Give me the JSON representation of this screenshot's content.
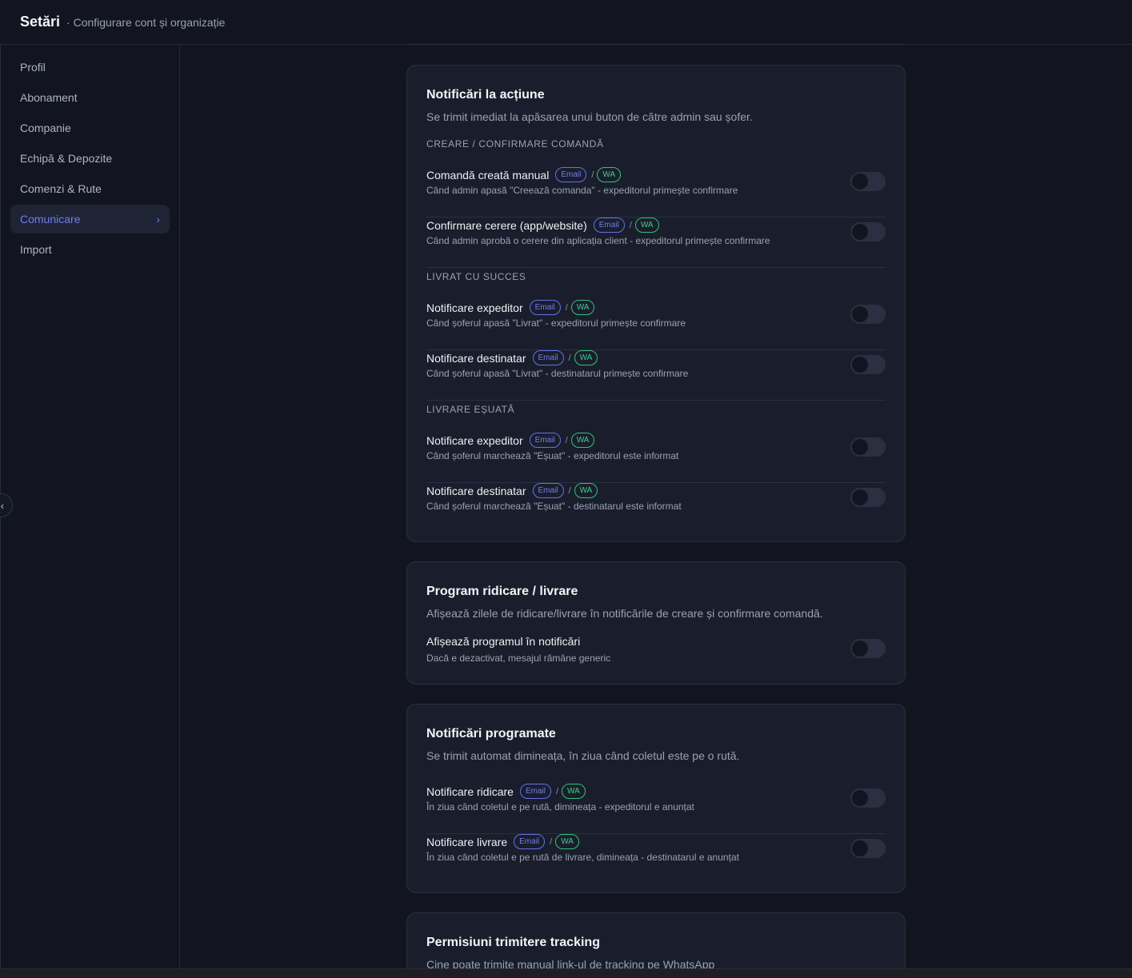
{
  "header": {
    "title": "Setări",
    "subtitle": "· Configurare cont și organizație"
  },
  "sidebar": {
    "items": [
      {
        "label": "Profil"
      },
      {
        "label": "Abonament"
      },
      {
        "label": "Companie"
      },
      {
        "label": "Echipă & Depozite"
      },
      {
        "label": "Comenzi & Rute"
      },
      {
        "label": "Comunicare",
        "active": true
      },
      {
        "label": "Import"
      }
    ],
    "active_chevron": "›",
    "collapse_icon": "‹"
  },
  "badges": {
    "email": "Email",
    "slash": "/",
    "wa": "WA"
  },
  "cards": {
    "action": {
      "title": "Notificări la acțiune",
      "description": "Se trimit imediat la apăsarea unui buton de către admin sau șofer.",
      "sections": [
        {
          "label": "CREARE / CONFIRMARE COMANDĂ",
          "rows": [
            {
              "title": "Comandă creată manual",
              "desc": "Când admin apasă \"Creează comanda\" - expeditorul primește confirmare",
              "enabled": false
            },
            {
              "title": "Confirmare cerere (app/website)",
              "desc": "Când admin aprobă o cerere din aplicația client - expeditorul primește confirmare",
              "enabled": false
            }
          ]
        },
        {
          "label": "LIVRAT CU SUCCES",
          "rows": [
            {
              "title": "Notificare expeditor",
              "desc": "Când șoferul apasă \"Livrat\" - expeditorul primește confirmare",
              "enabled": false
            },
            {
              "title": "Notificare destinatar",
              "desc": "Când șoferul apasă \"Livrat\" - destinatarul primește confirmare",
              "enabled": false
            }
          ]
        },
        {
          "label": "LIVRARE EȘUATĂ",
          "rows": [
            {
              "title": "Notificare expeditor",
              "desc": "Când șoferul marchează \"Eșuat\" - expeditorul este informat",
              "enabled": false
            },
            {
              "title": "Notificare destinatar",
              "desc": "Când șoferul marchează \"Eșuat\" - destinatarul este informat",
              "enabled": false
            }
          ]
        }
      ]
    },
    "schedule": {
      "title": "Program ridicare / livrare",
      "description": "Afișează zilele de ridicare/livrare în notificările de creare și confirmare comandă.",
      "row": {
        "title": "Afișează programul în notificări",
        "desc": "Dacă e dezactivat, mesajul rămâne generic",
        "enabled": false
      }
    },
    "scheduled": {
      "title": "Notificări programate",
      "description": "Se trimit automat dimineața, în ziua când coletul este pe o rută.",
      "rows": [
        {
          "title": "Notificare ridicare",
          "desc": "În ziua când coletul e pe rută, dimineața - expeditorul e anunțat",
          "enabled": false
        },
        {
          "title": "Notificare livrare",
          "desc": "În ziua când coletul e pe rută de livrare, dimineața - destinatarul e anunțat",
          "enabled": false
        }
      ]
    },
    "tracking": {
      "title": "Permisiuni trimitere tracking",
      "description": "Cine poate trimite manual link-ul de tracking pe WhatsApp"
    }
  }
}
